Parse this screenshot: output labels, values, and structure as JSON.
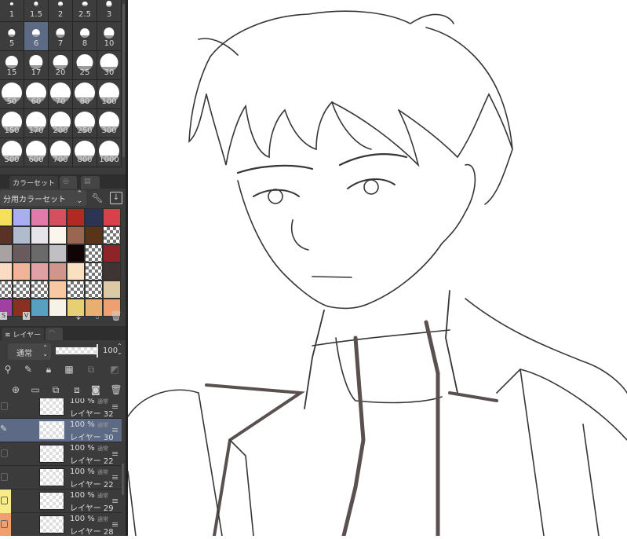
{
  "brush_sizes": {
    "items": [
      "1",
      "1.5",
      "2",
      "2.5",
      "3",
      "5",
      "6",
      "7",
      "8",
      "10",
      "15",
      "17",
      "20",
      "25",
      "30",
      "50",
      "60",
      "70",
      "80",
      "100",
      "150",
      "170",
      "200",
      "250",
      "300",
      "500",
      "600",
      "700",
      "800",
      "1000"
    ],
    "selected": "6"
  },
  "color_set": {
    "tab_label": "カラーセット",
    "dropdown_value": "分用カラーセット",
    "swatches": [
      "#f4e05a",
      "#a8aef0",
      "#e07aa8",
      "#d5505e",
      "#b02a22",
      "#2c3454",
      "#d8404a",
      "#5a3226",
      "#b0bccc",
      "#e6e4ea",
      "#faf6ee",
      "#9a6650",
      "#5a3418",
      "checker",
      "#a8a2a2",
      "#6a5a5e",
      "#6a6a6a",
      "#c0c0c4",
      "#100404",
      "checker",
      "#8e242a",
      "#fadcc4",
      "#f2b498",
      "#e0a0a6",
      "#d0968c",
      "#f8e0c0",
      "checker",
      "#3e3434",
      "checker",
      "checker",
      "checker",
      "#f8c8a2",
      "checker",
      "checker",
      "#dccaa6",
      "#a040a0",
      "#8a3020",
      "#58a0c0",
      "#f6f2e8",
      "#e6d070",
      "#e8b070",
      "#f0a070"
    ],
    "selected_index": 15,
    "footer_labels": [
      "S",
      "V"
    ]
  },
  "layers": {
    "tab_label": "レイヤー",
    "blend_mode": "通常",
    "opacity": "100",
    "items": [
      {
        "opacity": "100 %",
        "mode": "通常",
        "name": "レイヤー 32",
        "selected": false,
        "color": ""
      },
      {
        "opacity": "100 %",
        "mode": "通常",
        "name": "レイヤー 30",
        "selected": true,
        "color": ""
      },
      {
        "opacity": "100 %",
        "mode": "通常",
        "name": "レイヤー 22",
        "selected": false,
        "color": ""
      },
      {
        "opacity": "100 %",
        "mode": "通常",
        "name": "レイヤー 22",
        "selected": false,
        "color": ""
      },
      {
        "opacity": "100 %",
        "mode": "通常",
        "name": "レイヤー 29",
        "selected": false,
        "color": "#f8ec88"
      },
      {
        "opacity": "100 %",
        "mode": "通常",
        "name": "レイヤー 28",
        "selected": false,
        "color": "#f0a070"
      }
    ]
  },
  "colors": {
    "panel": "#3b3b3b",
    "selection": "#5d6a86",
    "ink": "#3a3535"
  }
}
